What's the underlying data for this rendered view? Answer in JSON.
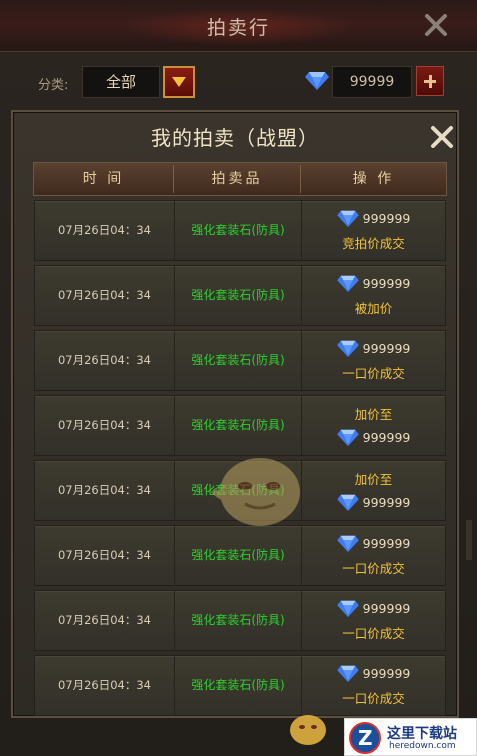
{
  "window": {
    "title": "拍卖行"
  },
  "filter": {
    "category_label": "分类:",
    "category_value": "全部"
  },
  "currency": {
    "icon": "diamond-icon",
    "amount": "99999"
  },
  "modal": {
    "title": "我的拍卖（战盟）",
    "columns": [
      "时 间",
      "拍卖品",
      "操 作"
    ],
    "rows": [
      {
        "time": "07月26日04：34",
        "item": "强化套装石(防具)",
        "amount": "999999",
        "status": "竞拍价成交",
        "layout": "amount-first"
      },
      {
        "time": "07月26日04：34",
        "item": "强化套装石(防具)",
        "amount": "999999",
        "status": "被加价",
        "layout": "amount-first"
      },
      {
        "time": "07月26日04：34",
        "item": "强化套装石(防具)",
        "amount": "999999",
        "status": "一口价成交",
        "layout": "amount-first"
      },
      {
        "time": "07月26日04：34",
        "item": "强化套装石(防具)",
        "amount": "999999",
        "status": "加价至",
        "layout": "status-first"
      },
      {
        "time": "07月26日04：34",
        "item": "强化套装石(防具)",
        "amount": "999999",
        "status": "加价至",
        "layout": "status-first"
      },
      {
        "time": "07月26日04：34",
        "item": "强化套装石(防具)",
        "amount": "999999",
        "status": "一口价成交",
        "layout": "amount-first"
      },
      {
        "time": "07月26日04：34",
        "item": "强化套装石(防具)",
        "amount": "999999",
        "status": "一口价成交",
        "layout": "amount-first"
      },
      {
        "time": "07月26日04：34",
        "item": "强化套装石(防具)",
        "amount": "999999",
        "status": "一口价成交",
        "layout": "amount-first"
      }
    ]
  },
  "colors": {
    "item_text": "#2ed12e",
    "status_text": "#f2c23a",
    "header_text": "#e6cfa0"
  },
  "watermark": {
    "name": "这里下载站",
    "url": "heredown.com"
  }
}
